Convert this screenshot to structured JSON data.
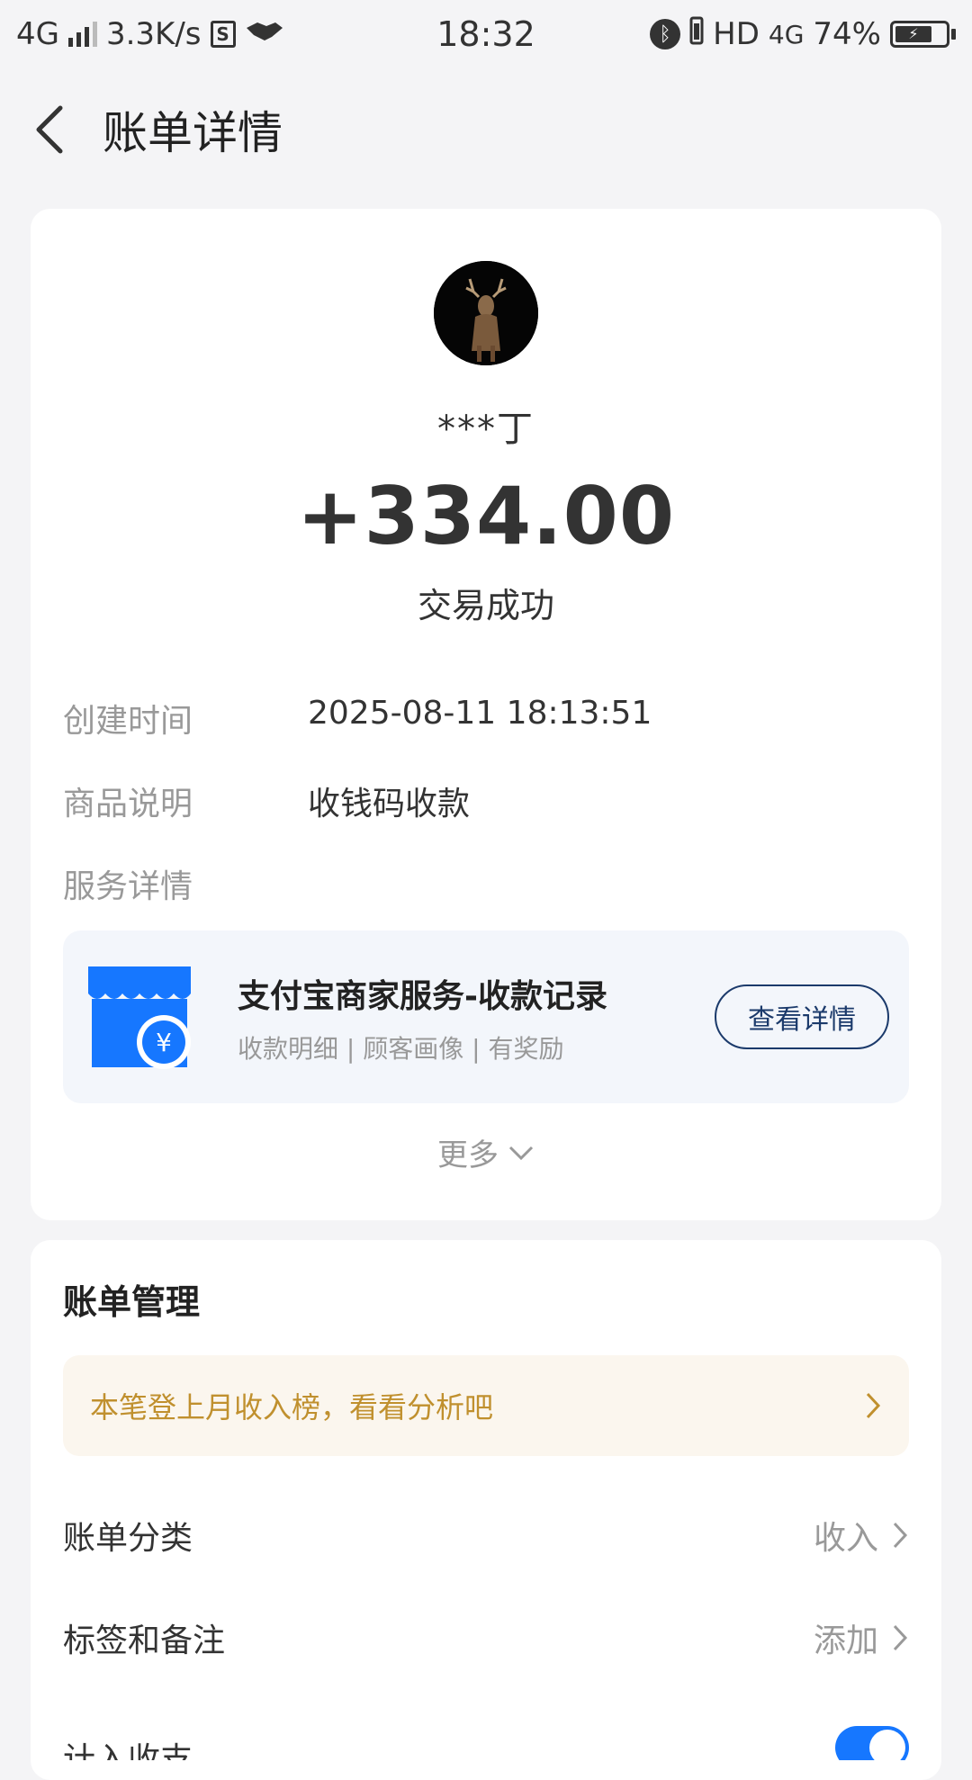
{
  "status_bar": {
    "network": "4G",
    "speed": "3.3K/s",
    "time": "18:32",
    "hd": "HD",
    "net_right": "4G",
    "battery": "74%"
  },
  "header": {
    "title": "账单详情"
  },
  "transaction": {
    "payer": "***丁",
    "amount": "+334.00",
    "status": "交易成功",
    "details": [
      {
        "label": "创建时间",
        "value": "2025-08-11 18:13:51"
      },
      {
        "label": "商品说明",
        "value": "收钱码收款"
      },
      {
        "label": "服务详情",
        "value": ""
      }
    ]
  },
  "service": {
    "title": "支付宝商家服务-收款记录",
    "subtitle": "收款明细 | 顾客画像 | 有奖励",
    "button": "查看详情",
    "icon_symbol": "¥"
  },
  "more": {
    "label": "更多"
  },
  "manage": {
    "title": "账单管理",
    "promo": "本笔登上月收入榜，看看分析吧",
    "rows": [
      {
        "label": "账单分类",
        "value": "收入"
      },
      {
        "label": "标签和备注",
        "value": "添加"
      }
    ],
    "partial_label": "计入收支"
  },
  "colors": {
    "accent_blue": "#1677ff",
    "promo_text": "#c0902e",
    "button_border": "#1b3a6b"
  }
}
